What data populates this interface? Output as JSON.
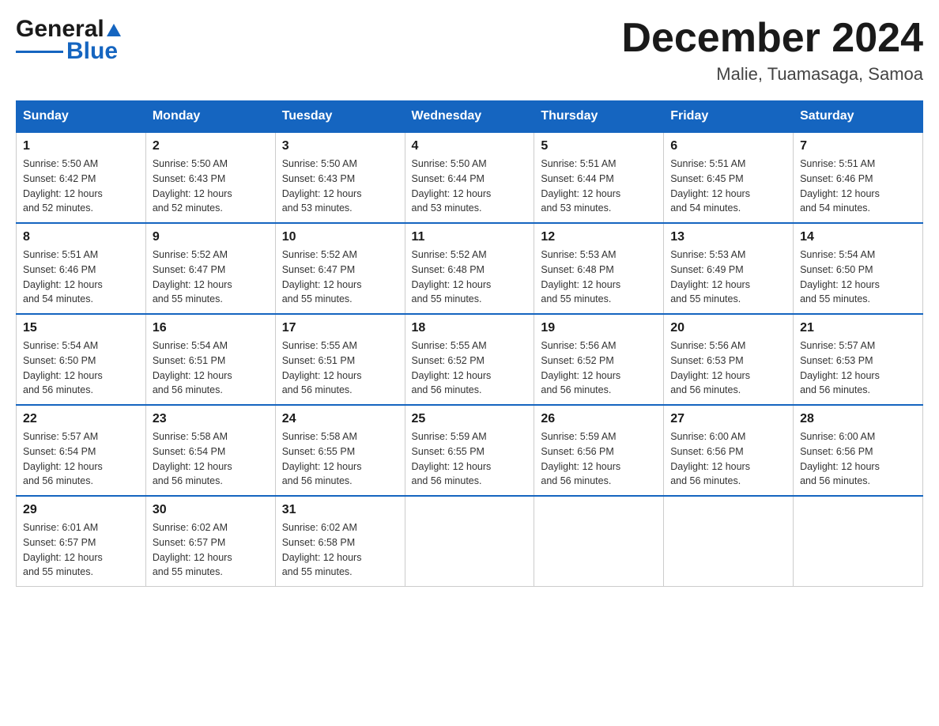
{
  "header": {
    "logo": {
      "general": "General",
      "blue": "Blue"
    },
    "title": "December 2024",
    "subtitle": "Malie, Tuamasaga, Samoa"
  },
  "days_of_week": [
    "Sunday",
    "Monday",
    "Tuesday",
    "Wednesday",
    "Thursday",
    "Friday",
    "Saturday"
  ],
  "weeks": [
    [
      {
        "day": "1",
        "sunrise": "5:50 AM",
        "sunset": "6:42 PM",
        "daylight": "12 hours and 52 minutes."
      },
      {
        "day": "2",
        "sunrise": "5:50 AM",
        "sunset": "6:43 PM",
        "daylight": "12 hours and 52 minutes."
      },
      {
        "day": "3",
        "sunrise": "5:50 AM",
        "sunset": "6:43 PM",
        "daylight": "12 hours and 53 minutes."
      },
      {
        "day": "4",
        "sunrise": "5:50 AM",
        "sunset": "6:44 PM",
        "daylight": "12 hours and 53 minutes."
      },
      {
        "day": "5",
        "sunrise": "5:51 AM",
        "sunset": "6:44 PM",
        "daylight": "12 hours and 53 minutes."
      },
      {
        "day": "6",
        "sunrise": "5:51 AM",
        "sunset": "6:45 PM",
        "daylight": "12 hours and 54 minutes."
      },
      {
        "day": "7",
        "sunrise": "5:51 AM",
        "sunset": "6:46 PM",
        "daylight": "12 hours and 54 minutes."
      }
    ],
    [
      {
        "day": "8",
        "sunrise": "5:51 AM",
        "sunset": "6:46 PM",
        "daylight": "12 hours and 54 minutes."
      },
      {
        "day": "9",
        "sunrise": "5:52 AM",
        "sunset": "6:47 PM",
        "daylight": "12 hours and 55 minutes."
      },
      {
        "day": "10",
        "sunrise": "5:52 AM",
        "sunset": "6:47 PM",
        "daylight": "12 hours and 55 minutes."
      },
      {
        "day": "11",
        "sunrise": "5:52 AM",
        "sunset": "6:48 PM",
        "daylight": "12 hours and 55 minutes."
      },
      {
        "day": "12",
        "sunrise": "5:53 AM",
        "sunset": "6:48 PM",
        "daylight": "12 hours and 55 minutes."
      },
      {
        "day": "13",
        "sunrise": "5:53 AM",
        "sunset": "6:49 PM",
        "daylight": "12 hours and 55 minutes."
      },
      {
        "day": "14",
        "sunrise": "5:54 AM",
        "sunset": "6:50 PM",
        "daylight": "12 hours and 55 minutes."
      }
    ],
    [
      {
        "day": "15",
        "sunrise": "5:54 AM",
        "sunset": "6:50 PM",
        "daylight": "12 hours and 56 minutes."
      },
      {
        "day": "16",
        "sunrise": "5:54 AM",
        "sunset": "6:51 PM",
        "daylight": "12 hours and 56 minutes."
      },
      {
        "day": "17",
        "sunrise": "5:55 AM",
        "sunset": "6:51 PM",
        "daylight": "12 hours and 56 minutes."
      },
      {
        "day": "18",
        "sunrise": "5:55 AM",
        "sunset": "6:52 PM",
        "daylight": "12 hours and 56 minutes."
      },
      {
        "day": "19",
        "sunrise": "5:56 AM",
        "sunset": "6:52 PM",
        "daylight": "12 hours and 56 minutes."
      },
      {
        "day": "20",
        "sunrise": "5:56 AM",
        "sunset": "6:53 PM",
        "daylight": "12 hours and 56 minutes."
      },
      {
        "day": "21",
        "sunrise": "5:57 AM",
        "sunset": "6:53 PM",
        "daylight": "12 hours and 56 minutes."
      }
    ],
    [
      {
        "day": "22",
        "sunrise": "5:57 AM",
        "sunset": "6:54 PM",
        "daylight": "12 hours and 56 minutes."
      },
      {
        "day": "23",
        "sunrise": "5:58 AM",
        "sunset": "6:54 PM",
        "daylight": "12 hours and 56 minutes."
      },
      {
        "day": "24",
        "sunrise": "5:58 AM",
        "sunset": "6:55 PM",
        "daylight": "12 hours and 56 minutes."
      },
      {
        "day": "25",
        "sunrise": "5:59 AM",
        "sunset": "6:55 PM",
        "daylight": "12 hours and 56 minutes."
      },
      {
        "day": "26",
        "sunrise": "5:59 AM",
        "sunset": "6:56 PM",
        "daylight": "12 hours and 56 minutes."
      },
      {
        "day": "27",
        "sunrise": "6:00 AM",
        "sunset": "6:56 PM",
        "daylight": "12 hours and 56 minutes."
      },
      {
        "day": "28",
        "sunrise": "6:00 AM",
        "sunset": "6:56 PM",
        "daylight": "12 hours and 56 minutes."
      }
    ],
    [
      {
        "day": "29",
        "sunrise": "6:01 AM",
        "sunset": "6:57 PM",
        "daylight": "12 hours and 55 minutes."
      },
      {
        "day": "30",
        "sunrise": "6:02 AM",
        "sunset": "6:57 PM",
        "daylight": "12 hours and 55 minutes."
      },
      {
        "day": "31",
        "sunrise": "6:02 AM",
        "sunset": "6:58 PM",
        "daylight": "12 hours and 55 minutes."
      },
      null,
      null,
      null,
      null
    ]
  ],
  "labels": {
    "sunrise": "Sunrise:",
    "sunset": "Sunset:",
    "daylight": "Daylight:"
  }
}
